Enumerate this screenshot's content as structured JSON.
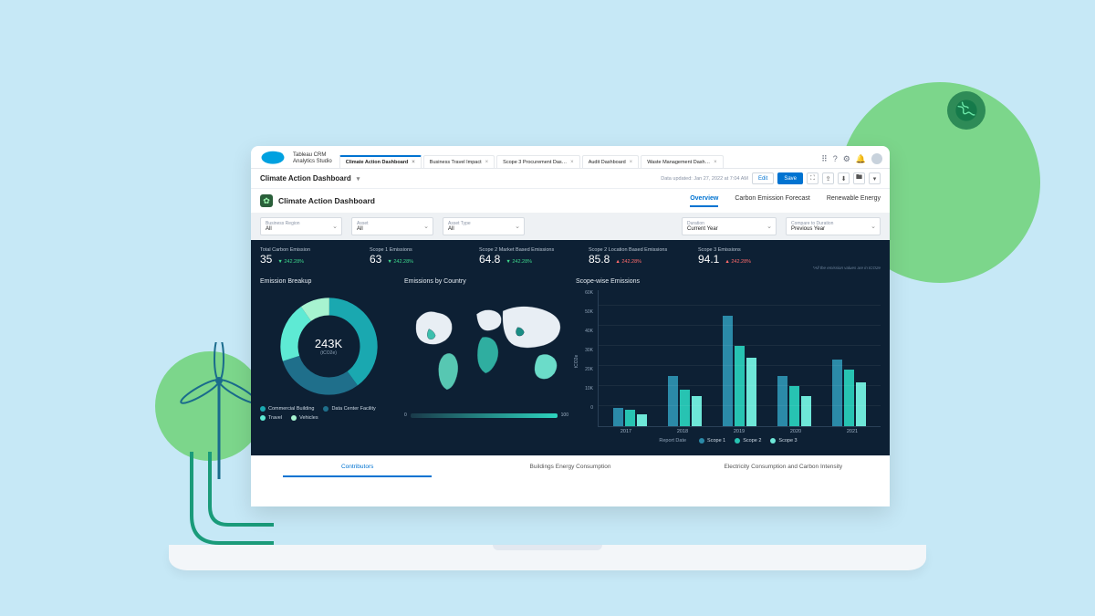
{
  "app": {
    "product_line1": "Tableau CRM",
    "product_line2": "Analytics Studio"
  },
  "tabs": [
    {
      "label": "Climate Action Dashboard",
      "active": true
    },
    {
      "label": "Business Travel Impact",
      "active": false
    },
    {
      "label": "Scope 3 Procurement Das…",
      "active": false
    },
    {
      "label": "Audit Dashboard",
      "active": false
    },
    {
      "label": "Waste Management Dash…",
      "active": false
    }
  ],
  "subbar": {
    "title": "Climate Action Dashboard",
    "updated": "Data updated: Jan 27, 2022 at 7:04 AM",
    "edit": "Edit",
    "save": "Save"
  },
  "dashboard": {
    "title": "Climate Action Dashboard",
    "view_tabs": [
      "Overview",
      "Carbon Emission Forecast",
      "Renewable Energy"
    ]
  },
  "filters": [
    {
      "label": "Business Region",
      "value": "All"
    },
    {
      "label": "Asset",
      "value": "All"
    },
    {
      "label": "Asset Type",
      "value": "All"
    },
    {
      "label": "Duration",
      "value": "Current Year"
    },
    {
      "label": "Compare to Duration",
      "value": "Previous Year"
    }
  ],
  "kpis": [
    {
      "label": "Total Carbon Emission",
      "value": "35",
      "delta": "242.28%",
      "dir": "down"
    },
    {
      "label": "Scope 1 Emissions",
      "value": "63",
      "delta": "242.28%",
      "dir": "down"
    },
    {
      "label": "Scope 2 Market Based Emissions",
      "value": "64.8",
      "delta": "242.28%",
      "dir": "down"
    },
    {
      "label": "Scope 2 Location Based Emissions",
      "value": "85.8",
      "delta": "242.28%",
      "dir": "up"
    },
    {
      "label": "Scope 3 Emissions",
      "value": "94.1",
      "delta": "242.28%",
      "dir": "up"
    }
  ],
  "kpi_footnote": "*All the emission values are in tCO2e",
  "donut": {
    "title": "Emission Breakup",
    "center_value": "243K",
    "center_unit": "(tCO2e)",
    "legend": [
      {
        "label": "Commercial Building",
        "color": "#1aa8b0"
      },
      {
        "label": "Data Center Facility",
        "color": "#1f6f8b"
      },
      {
        "label": "Travel",
        "color": "#5eead4"
      },
      {
        "label": "Vehicles",
        "color": "#a7f3d0"
      }
    ]
  },
  "map": {
    "title": "Emissions by Country",
    "scale_min": "0",
    "scale_max": "100"
  },
  "bars": {
    "title": "Scope-wise Emissions",
    "y_label": "tCO2e",
    "x_label": "Report Date",
    "legend": [
      "Scope 1",
      "Scope 2",
      "Scope 3"
    ]
  },
  "bottom_tabs": [
    "Contributors",
    "Buildings Energy Consumption",
    "Electricity Consumption and Carbon Intensity"
  ],
  "chart_data": {
    "donut": {
      "type": "pie",
      "title": "Emission Breakup",
      "total_label": "243K",
      "total_unit": "tCO2e",
      "slices": [
        {
          "name": "Commercial Building",
          "value": 97,
          "color": "#1aa8b0"
        },
        {
          "name": "Data Center Facility",
          "value": 73,
          "color": "#1f6f8b"
        },
        {
          "name": "Travel",
          "value": 49,
          "color": "#5eead4"
        },
        {
          "name": "Vehicles",
          "value": 24,
          "color": "#a7f3d0"
        }
      ]
    },
    "scope_bars": {
      "type": "bar",
      "title": "Scope-wise Emissions",
      "ylabel": "tCO2e",
      "xlabel": "Report Date",
      "ylim": [
        0,
        60000
      ],
      "yticks": [
        0,
        10000,
        20000,
        30000,
        40000,
        50000,
        60000
      ],
      "ytick_labels": [
        "0",
        "10K",
        "20K",
        "30K",
        "40K",
        "50K",
        "60K"
      ],
      "categories": [
        "2017",
        "2018",
        "2019",
        "2020",
        "2021"
      ],
      "series": [
        {
          "name": "Scope 1",
          "color": "#2b8aa8",
          "values": [
            9000,
            25000,
            55000,
            25000,
            33000
          ]
        },
        {
          "name": "Scope 2",
          "color": "#27c3b2",
          "values": [
            8000,
            18000,
            40000,
            20000,
            28000
          ]
        },
        {
          "name": "Scope 3",
          "color": "#6ee7d8",
          "values": [
            6000,
            15000,
            34000,
            15000,
            22000
          ]
        }
      ]
    }
  }
}
